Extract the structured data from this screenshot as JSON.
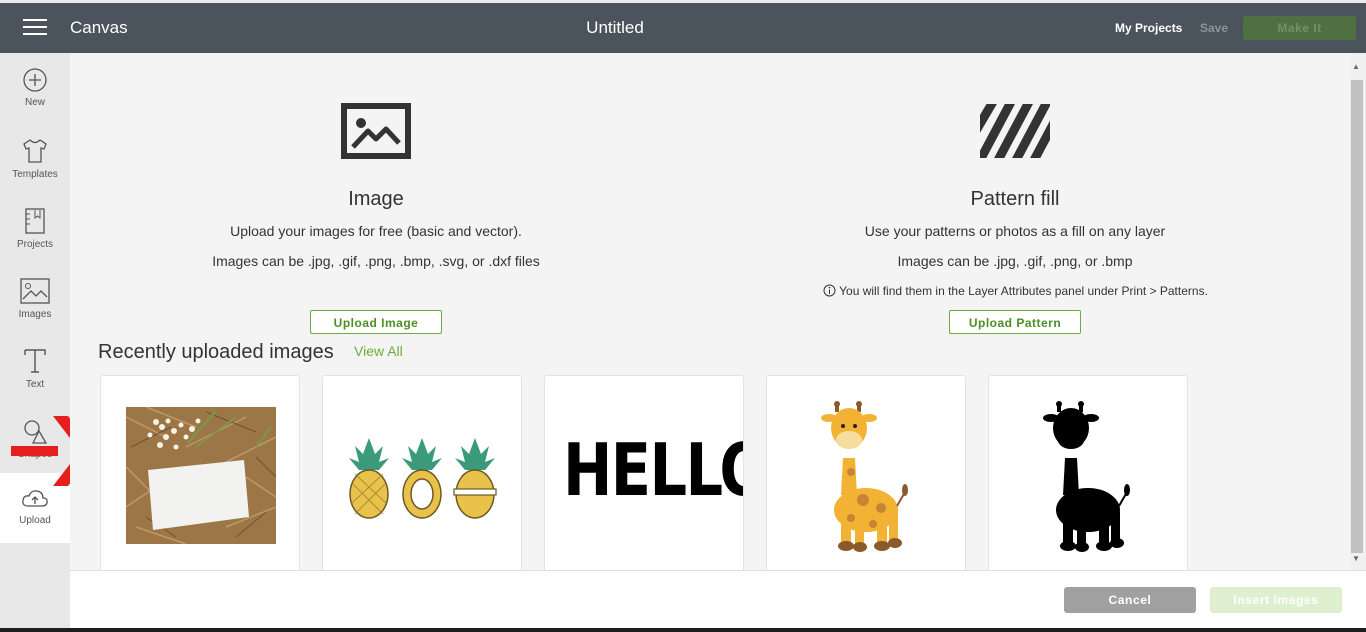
{
  "header": {
    "app_title": "Canvas",
    "doc_title": "Untitled",
    "my_projects": "My Projects",
    "save": "Save",
    "make_it": "Make It"
  },
  "sidebar": {
    "items": [
      {
        "label": "New",
        "icon": "plus-circle-icon"
      },
      {
        "label": "Templates",
        "icon": "shirt-icon"
      },
      {
        "label": "Projects",
        "icon": "notebook-icon"
      },
      {
        "label": "Images",
        "icon": "image-icon"
      },
      {
        "label": "Text",
        "icon": "text-icon"
      },
      {
        "label": "Shapes",
        "icon": "shapes-icon"
      },
      {
        "label": "Upload",
        "icon": "cloud-upload-icon"
      }
    ],
    "active": "Upload"
  },
  "image_section": {
    "title": "Image",
    "line1": "Upload your images for free (basic and vector).",
    "line2": "Images can be .jpg, .gif, .png, .bmp, .svg, or .dxf files",
    "button": "Upload Image"
  },
  "pattern_section": {
    "title": "Pattern fill",
    "line1": "Use your patterns or photos as a fill on any layer",
    "line2": "Images can be .jpg, .gif, .png, or .bmp",
    "info": "You will find them in the Layer Attributes panel under Print > Patterns.",
    "button": "Upload Pattern"
  },
  "recent": {
    "title": "Recently uploaded images",
    "view_all": "View All",
    "thumbnails": [
      {
        "name": "photo-flowers-card"
      },
      {
        "name": "pineapples"
      },
      {
        "name": "hello-text",
        "text": "HELLO"
      },
      {
        "name": "giraffe-color"
      },
      {
        "name": "giraffe-silhouette"
      }
    ]
  },
  "footer": {
    "cancel": "Cancel",
    "insert": "Insert Images"
  },
  "colors": {
    "header_bg": "#4b545c",
    "accent_green": "#6aad3a",
    "arrow_red": "#e61e1e"
  }
}
